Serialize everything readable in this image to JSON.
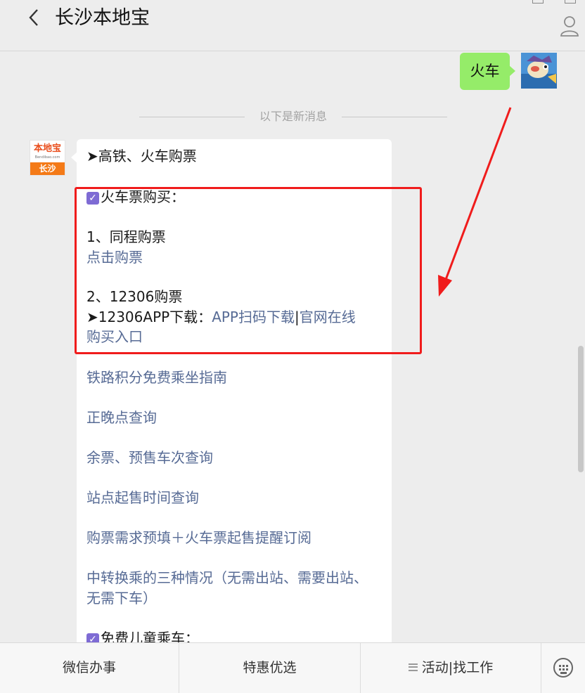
{
  "header": {
    "title": "长沙本地宝",
    "back_icon": "chevron-left-icon",
    "profile_icon": "person-icon"
  },
  "chat": {
    "my_message": "火车",
    "divider_text": "以下是新消息",
    "bot_avatar": {
      "brand": "本地宝",
      "domain": "Bendibao.com",
      "city": "长沙"
    },
    "bot_lines": {
      "intro": "➤高铁、火车购票",
      "ticket_header": "火车票购买：",
      "tongcheng": "1、同程购票",
      "tongcheng_link": "点击购票",
      "t12306": "2、12306购票",
      "app_prefix": "➤12306APP下载：",
      "app_link": "APP扫码下载",
      "pipe": "|",
      "official_link_1": "官网在线",
      "official_link_2": "购买入口",
      "links": [
        "铁路积分免费乘坐指南",
        "正晚点查询",
        "余票、预售车次查询",
        "站点起售时间查询",
        "购票需求预填＋火车票起售提醒订阅"
      ],
      "transfer_1": "中转换乘的三种情况（无需出站、需要出站、",
      "transfer_2": "无需下车）",
      "child_header": "免费儿童乘车："
    }
  },
  "bottom_menu": {
    "item1": "微信办事",
    "item2": "特惠优选",
    "item3": "活动|找工作",
    "keyboard_icon": "keyboard-icon"
  },
  "colors": {
    "bubble_green": "#95ec69",
    "link_blue": "#576b95",
    "highlight_red": "#f01c1c",
    "checkbox_purple": "#7e6bd4"
  }
}
